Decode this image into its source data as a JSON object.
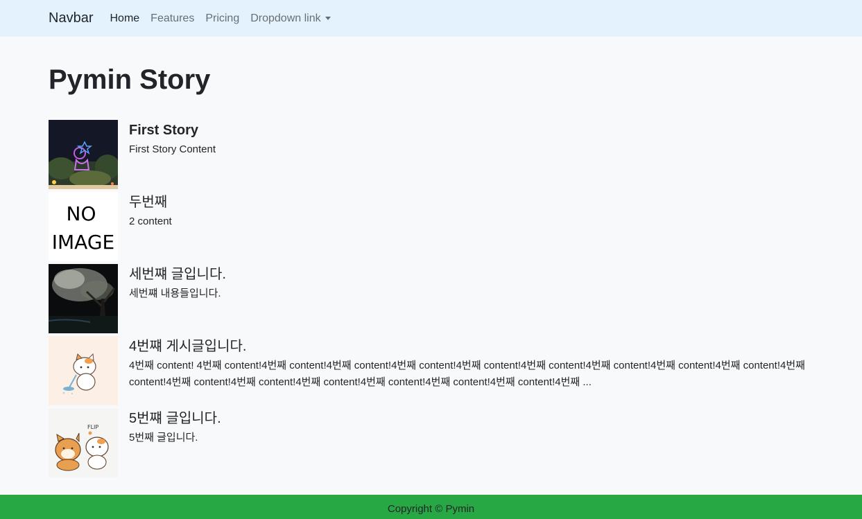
{
  "navbar": {
    "brand": "Navbar",
    "links": [
      {
        "label": "Home"
      },
      {
        "label": "Features"
      },
      {
        "label": "Pricing"
      },
      {
        "label": "Dropdown link"
      }
    ]
  },
  "page": {
    "title": "Pymin Story"
  },
  "stories": [
    {
      "title": "First Story",
      "content": "First Story Content",
      "image": "night-drone-show"
    },
    {
      "title": "두번째",
      "content": "2 content",
      "image": "no-image-placeholder",
      "image_text_1": "NO",
      "image_text_2": "IMAGE"
    },
    {
      "title": "세번쨰 글입니다.",
      "content": "세번쨰 내용들입니다.",
      "image": "night-cherry-blossom"
    },
    {
      "title": "4번쨰 게시글입니다.",
      "content": "4번째 content! 4번째 content!4번째 content!4번째 content!4번째 content!4번째 content!4번째 content!4번째 content!4번째 content!4번째 content!4번째 content!4번째 content!4번째 content!4번째 content!4번째 content!4번째 content!4번째 content!4번째 ...",
      "image": "cat-cleaning-sticker"
    },
    {
      "title": "5번쨰 글입니다.",
      "content": "5번째 글입니다.",
      "image": "dog-and-cat-sticker"
    }
  ],
  "footer": {
    "text": "Copyright © Pymin"
  },
  "colors": {
    "navbar_bg": "#e3f2fd",
    "footer_bg": "#28a745",
    "page_bg": "#f8f9fa"
  }
}
